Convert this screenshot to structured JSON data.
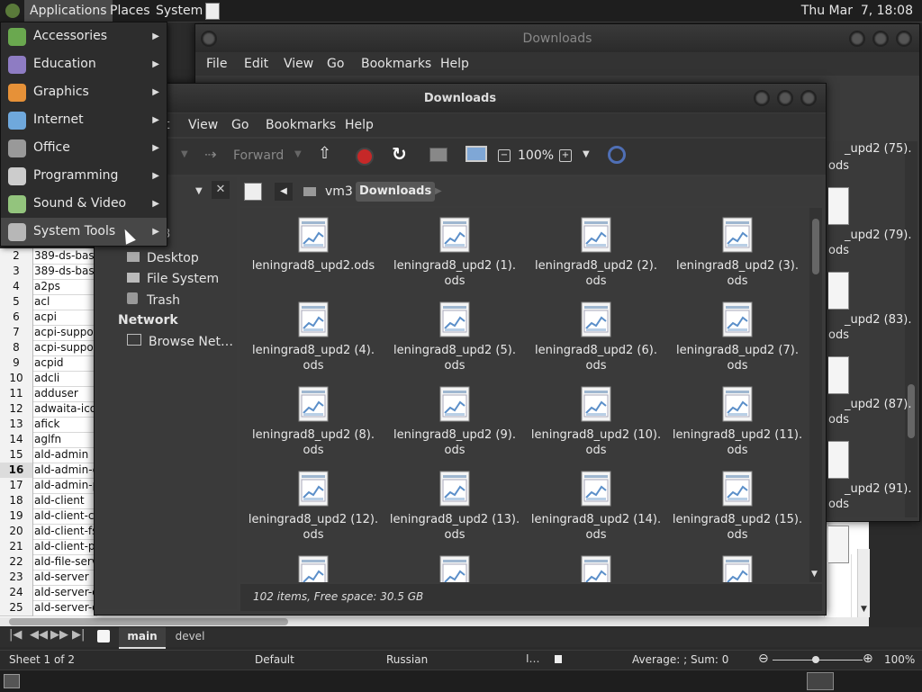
{
  "top_panel": {
    "applications": "Applications",
    "places": "Places",
    "system": "System",
    "clock": "Thu Mar  7, 18:08"
  },
  "app_menu": {
    "items": [
      {
        "label": "Accessories",
        "icon": "accessories-icon",
        "color": "#6aa84f"
      },
      {
        "label": "Education",
        "icon": "education-icon",
        "color": "#8e7cc3"
      },
      {
        "label": "Graphics",
        "icon": "graphics-icon",
        "color": "#e69138"
      },
      {
        "label": "Internet",
        "icon": "internet-icon",
        "color": "#6fa8dc"
      },
      {
        "label": "Office",
        "icon": "office-icon",
        "color": "#999999"
      },
      {
        "label": "Programming",
        "icon": "programming-icon",
        "color": "#cccccc"
      },
      {
        "label": "Sound & Video",
        "icon": "sound-video-icon",
        "color": "#93c47d"
      },
      {
        "label": "System Tools",
        "icon": "system-tools-icon",
        "color": "#b7b7b7"
      }
    ]
  },
  "back_window": {
    "title": "Downloads",
    "menu": [
      "File",
      "Edit",
      "View",
      "Go",
      "Bookmarks",
      "Help"
    ],
    "partial_items": [
      "_upd2 (75).",
      "ods",
      "_upd2 (79).",
      "ods",
      "_upd2 (83).",
      "ods",
      "_upd2 (87).",
      "ods",
      "_upd2 (91).",
      "ods"
    ]
  },
  "front_window": {
    "title": "Downloads",
    "menu": [
      "t",
      "View",
      "Go",
      "Bookmarks",
      "Help"
    ],
    "toolbar": {
      "forward": "Forward",
      "zoom": "100%"
    },
    "path": {
      "parent": "vm3",
      "current": "Downloads"
    },
    "sidebar": {
      "partial_header": "er",
      "partial_item": "3",
      "items": [
        "Desktop",
        "File System",
        "Trash"
      ],
      "network_header": "Network",
      "network_items": [
        "Browse Net…"
      ]
    },
    "files": [
      [
        "leningrad8_upd2.ods",
        ""
      ],
      [
        "leningrad8_upd2 (1).",
        "ods"
      ],
      [
        "leningrad8_upd2 (2).",
        "ods"
      ],
      [
        "leningrad8_upd2 (3).",
        "ods"
      ],
      [
        "leningrad8_upd2 (4).",
        "ods"
      ],
      [
        "leningrad8_upd2 (5).",
        "ods"
      ],
      [
        "leningrad8_upd2 (6).",
        "ods"
      ],
      [
        "leningrad8_upd2 (7).",
        "ods"
      ],
      [
        "leningrad8_upd2 (8).",
        "ods"
      ],
      [
        "leningrad8_upd2 (9).",
        "ods"
      ],
      [
        "leningrad8_upd2 (10).",
        "ods"
      ],
      [
        "leningrad8_upd2 (11).",
        "ods"
      ],
      [
        "leningrad8_upd2 (12).",
        "ods"
      ],
      [
        "leningrad8_upd2 (13).",
        "ods"
      ],
      [
        "leningrad8_upd2 (14).",
        "ods"
      ],
      [
        "leningrad8_upd2 (15).",
        "ods"
      ]
    ],
    "status": "102 items, Free space: 30.5 GB"
  },
  "spreadsheet": {
    "rows": [
      [
        "2",
        "389-ds-bas"
      ],
      [
        "3",
        "389-ds-bas"
      ],
      [
        "4",
        "a2ps"
      ],
      [
        "5",
        "acl"
      ],
      [
        "6",
        "acpi"
      ],
      [
        "7",
        "acpi-suppor"
      ],
      [
        "8",
        "acpi-suppor"
      ],
      [
        "9",
        "acpid"
      ],
      [
        "10",
        "adcli"
      ],
      [
        "11",
        "adduser"
      ],
      [
        "12",
        "adwaita-ico"
      ],
      [
        "13",
        "afick"
      ],
      [
        "14",
        "aglfn"
      ],
      [
        "15",
        "ald-admin"
      ],
      [
        "16",
        "ald-admin-c"
      ],
      [
        "17",
        "ald-admin-p"
      ],
      [
        "18",
        "ald-client"
      ],
      [
        "19",
        "ald-client-co"
      ],
      [
        "20",
        "ald-client-fs"
      ],
      [
        "21",
        "ald-client-pa"
      ],
      [
        "22",
        "ald-file-serv"
      ],
      [
        "23",
        "ald-server"
      ],
      [
        "24",
        "ald-server-c"
      ],
      [
        "25",
        "ald-server-d"
      ]
    ],
    "selected_row": "16",
    "tabs": [
      "main",
      "devel"
    ],
    "active_tab": "main"
  },
  "status_bar": {
    "sheet": "Sheet 1 of 2",
    "style": "Default",
    "language": "Russian",
    "summary": "Average: ; Sum: 0",
    "zoom": "100%"
  }
}
